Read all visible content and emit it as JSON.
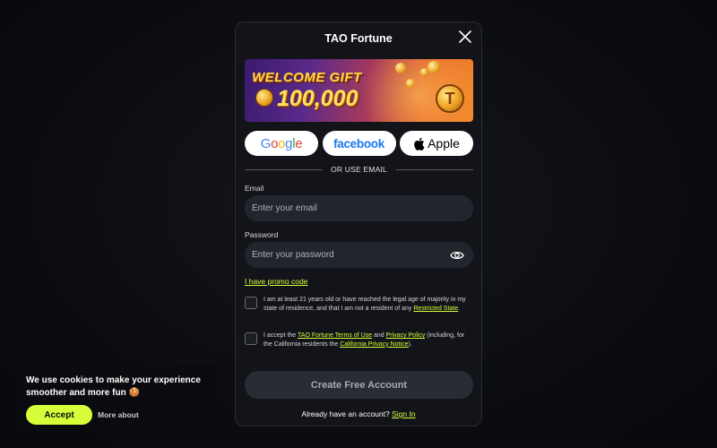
{
  "modal": {
    "title": "TAO Fortune",
    "banner": {
      "title": "WELCOME GIFT",
      "amount": "100,000",
      "coin_glyph": "T"
    },
    "social": {
      "google": "Google",
      "facebook": "facebook",
      "apple": "Apple"
    },
    "divider_text": "OR USE EMAIL",
    "email": {
      "label": "Email",
      "placeholder": "Enter your email",
      "value": ""
    },
    "password": {
      "label": "Password",
      "placeholder": "Enter your password",
      "value": ""
    },
    "promo_link": "I have promo code",
    "age_check": {
      "text": "I am at least 21 years old or have reached the legal age of majority in my state of residence, and that I am not a resident of any",
      "link": "Restricted State",
      "end": "."
    },
    "terms_check": {
      "pre": "I accept the",
      "terms_link": "TAO Fortune Terms of Use",
      "and": "and",
      "privacy_link": "Privacy Policy",
      "mid": "(including, for the California residents the",
      "ca_link": "California Privacy Notice",
      "end": ")."
    },
    "create_button": "Create Free Account",
    "signin_prompt": "Already have an account?",
    "signin_link": "Sign In"
  },
  "cookie_banner": {
    "text": "We use cookies to make your experience smoother and more fun 🍪",
    "accept": "Accept",
    "more": "More about"
  },
  "colors": {
    "accent": "#d6ff3a",
    "modal_bg": "#131419",
    "input_bg": "#23252d",
    "facebook_blue": "#1877f2"
  }
}
